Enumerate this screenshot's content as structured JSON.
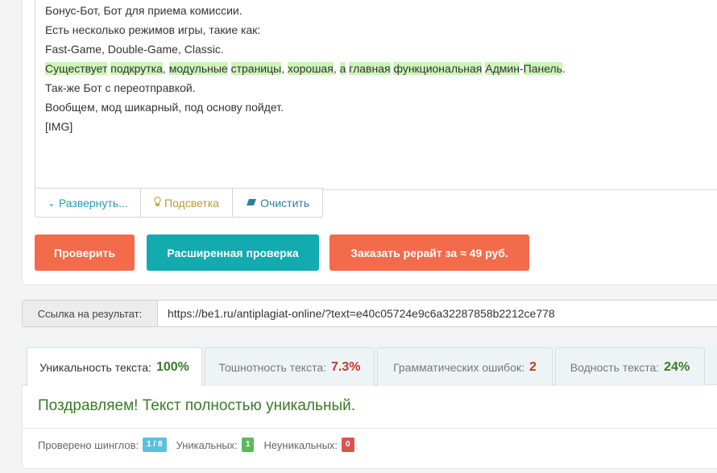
{
  "editor": {
    "lines": [
      "Бонус-Бот, Бот для приема комиссии.",
      "Есть несколько режимов игры, такие как:",
      "Fast-Game, Double-Game, Classic.",
      "",
      "Так-же Бот с переотправкой.",
      "Вообщем, мод шикарный, под основу пойдет.",
      "[IMG]"
    ],
    "highlight_line": {
      "w1": "Существует",
      "w2": "подкрутка",
      "w3": "модульные",
      "w4": "страницы",
      "w5": "хорошая",
      "w6": "а",
      "w7": "главная",
      "w8": "функциональная",
      "w9": "Админ",
      "w10": "Панель"
    }
  },
  "toolbar": {
    "expand_label": "Развернуть...",
    "highlight_label": "Подсветка",
    "clear_label": "Очистить"
  },
  "actions": {
    "check_label": "Проверить",
    "extended_label": "Расширенная проверка",
    "order_label": "Заказать рерайт за ≈ 49 руб."
  },
  "result_link": {
    "label": "Ссылка на результат:",
    "url": "https://be1.ru/antiplagiat-online/?text=e40c05724e9c6a32287858b2212ce778"
  },
  "tabs": [
    {
      "label": "Уникальность текста:",
      "value": "100%"
    },
    {
      "label": "Тошнотность текста:",
      "value": "7.3%"
    },
    {
      "label": "Грамматических ошибок:",
      "value": "2"
    },
    {
      "label": "Водность текста:",
      "value": "24%"
    }
  ],
  "result": {
    "message": "Поздравляем! Текст полностью уникальный.",
    "shingles_label": "Проверено шинглов:",
    "shingles_value": "1 / 8",
    "unique_label": "Уникальных:",
    "unique_value": "1",
    "nonunique_label": "Неуникальных:",
    "nonunique_value": "0"
  },
  "colors": {
    "accent_orange": "#f26b4a",
    "accent_teal": "#13aab0",
    "success_green": "#3a7a26",
    "highlight_green": "#cdf5b8"
  }
}
